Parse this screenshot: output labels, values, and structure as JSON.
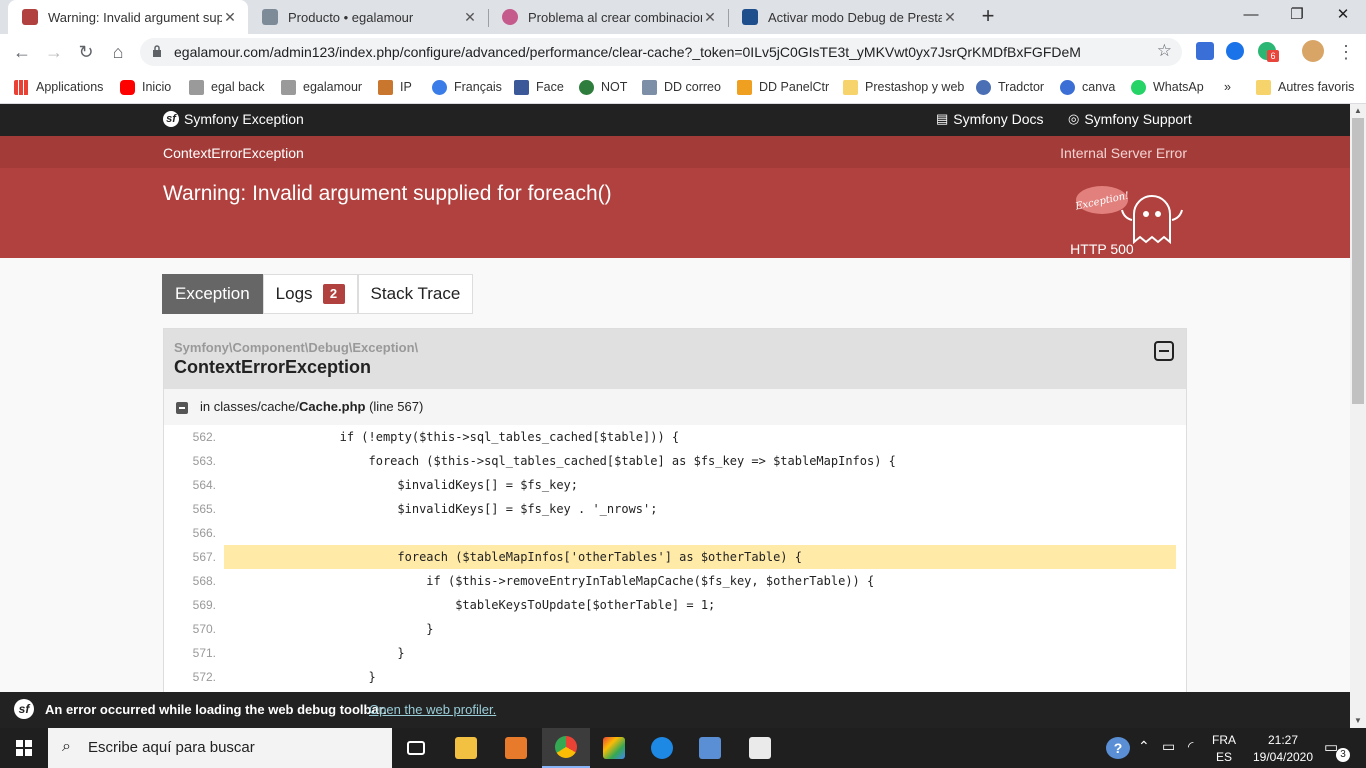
{
  "browser": {
    "tabs": [
      {
        "title": "Warning: Invalid argument suppl",
        "active": true,
        "favicon": "symfony-ghost-icon"
      },
      {
        "title": "Producto • egalamour",
        "active": false,
        "favicon": "prestashop-icon"
      },
      {
        "title": "Problema al crear combinaciones",
        "active": false,
        "favicon": "prestashop-forum-icon"
      },
      {
        "title": "Activar modo Debug de Prestash",
        "active": false,
        "favicon": "eye-icon"
      }
    ],
    "url": "egalamour.com/admin123/index.php/configure/advanced/performance/clear-cache?_token=0ILv5jC0GIsTE3t_yMKVwt0yx7JsrQrKMDfBxFGFDeM",
    "extension_badge": "6",
    "bookmarks": [
      "Applications",
      "Inicio",
      "egal back",
      "egalamour",
      "IP",
      "Français",
      "Face",
      "NOT",
      "DD correo",
      "DD PanelCtr",
      "Prestashop y web",
      "Tradctor",
      "canva",
      "WhatsAp",
      "»",
      "Autres favoris"
    ]
  },
  "symfony": {
    "header": {
      "brand": "Symfony Exception",
      "docs": "Symfony Docs",
      "support": "Symfony Support"
    },
    "exception_class": "ContextErrorException",
    "http_code": "HTTP 500",
    "http_text": "Internal Server Error",
    "message": "Warning: Invalid argument supplied for foreach()",
    "ghost_label": "Exception!",
    "tabs": {
      "exception": "Exception",
      "logs": "Logs",
      "logs_count": "2",
      "stack_trace": "Stack Trace"
    },
    "exception_namespace": "Symfony\\Component\\Debug\\Exception\\",
    "exception_name": "ContextErrorException",
    "trace": {
      "prefix": "in classes/cache/",
      "file": "Cache.php",
      "line": "(line 567)"
    },
    "code_lines": [
      {
        "n": "562.",
        "code": "                if (!empty($this->sql_tables_cached[$table])) {"
      },
      {
        "n": "563.",
        "code": "                    foreach ($this->sql_tables_cached[$table] as $fs_key => $tableMapInfos) {"
      },
      {
        "n": "564.",
        "code": "                        $invalidKeys[] = $fs_key;"
      },
      {
        "n": "565.",
        "code": "                        $invalidKeys[] = $fs_key . '_nrows';"
      },
      {
        "n": "566.",
        "code": ""
      },
      {
        "n": "567.",
        "code": "                        foreach ($tableMapInfos['otherTables'] as $otherTable) {"
      },
      {
        "n": "568.",
        "code": "                            if ($this->removeEntryInTableMapCache($fs_key, $otherTable)) {"
      },
      {
        "n": "569.",
        "code": "                                $tableKeysToUpdate[$otherTable] = 1;"
      },
      {
        "n": "570.",
        "code": "                            }"
      },
      {
        "n": "571.",
        "code": "                        }"
      },
      {
        "n": "572.",
        "code": "                    }"
      }
    ],
    "highlight_line": "567.",
    "debug_toolbar": {
      "message": "An error occurred while loading the web debug toolbar.",
      "link": "Open the web profiler."
    }
  },
  "taskbar": {
    "search_placeholder": "Escribe aquí para buscar",
    "lang_top": "FRA",
    "lang_bottom": "ES",
    "time": "21:27",
    "date": "19/04/2020",
    "notifications": "3"
  },
  "colors": {
    "accent_red": "#b0413e",
    "dark": "#222222",
    "highlight": "#ffeaa8"
  }
}
